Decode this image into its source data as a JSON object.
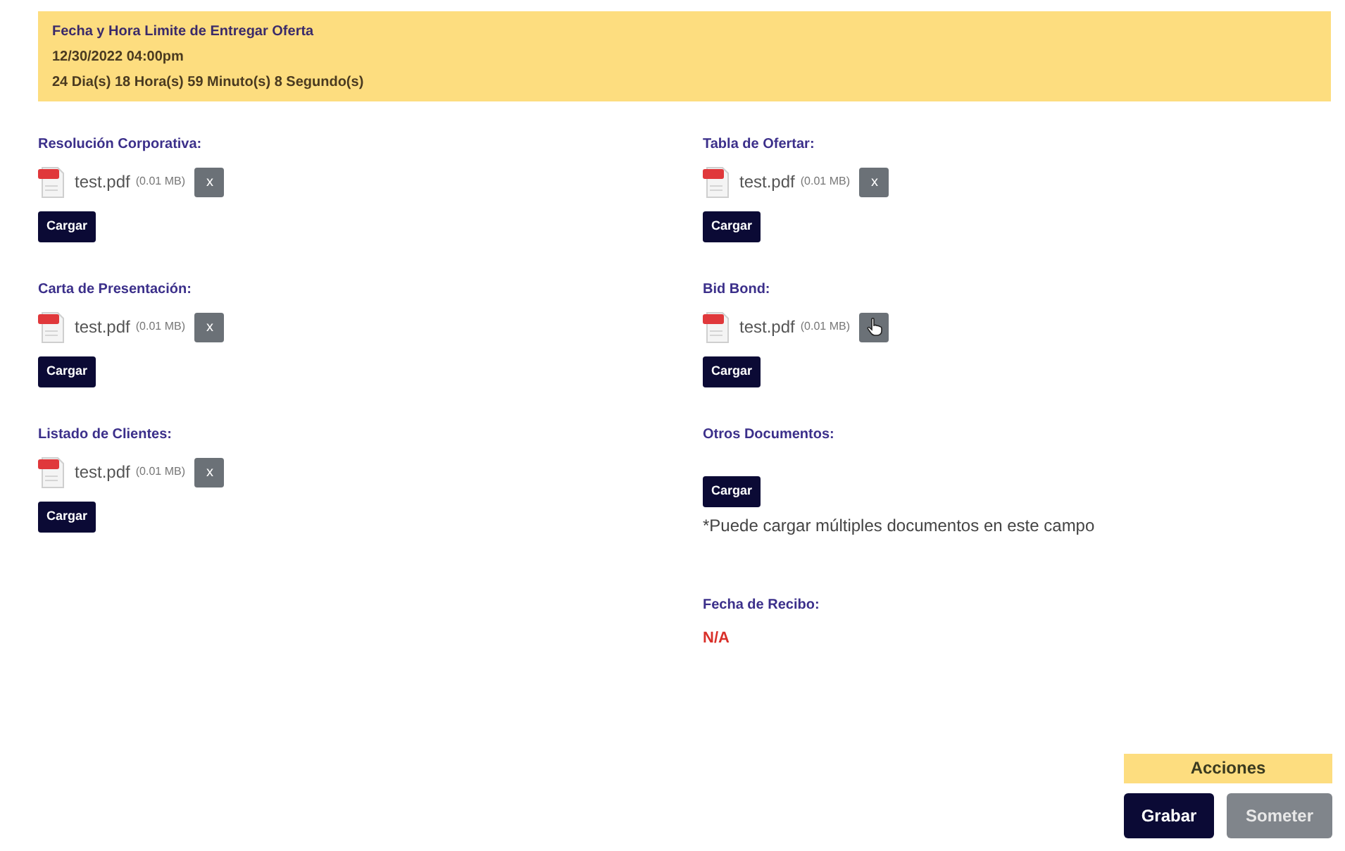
{
  "deadline": {
    "title": "Fecha y Hora Limite de Entregar Oferta",
    "date": "12/30/2022 04:00pm",
    "countdown": "24 Dia(s) 18 Hora(s) 59 Minuto(s) 8 Segundo(s)"
  },
  "left_column": [
    {
      "label": "Resolución Corporativa:",
      "files": [
        {
          "name": "test.pdf",
          "size": "(0.01 MB)",
          "remove": "x",
          "hovered": false
        }
      ],
      "upload_button": "Cargar"
    },
    {
      "label": "Carta de Presentación:",
      "files": [
        {
          "name": "test.pdf",
          "size": "(0.01 MB)",
          "remove": "x",
          "hovered": false
        }
      ],
      "upload_button": "Cargar"
    },
    {
      "label": "Listado de Clientes:",
      "files": [
        {
          "name": "test.pdf",
          "size": "(0.01 MB)",
          "remove": "x",
          "hovered": false
        }
      ],
      "upload_button": "Cargar"
    }
  ],
  "right_column": [
    {
      "label": "Tabla de Ofertar:",
      "files": [
        {
          "name": "test.pdf",
          "size": "(0.01 MB)",
          "remove": "x",
          "hovered": false
        }
      ],
      "upload_button": "Cargar"
    },
    {
      "label": "Bid Bond:",
      "files": [
        {
          "name": "test.pdf",
          "size": "(0.01 MB)",
          "hovered": true
        }
      ],
      "upload_button": "Cargar"
    },
    {
      "label": "Otros Documentos:",
      "upload_button": "Cargar",
      "note": "*Puede cargar múltiples documentos en este campo"
    }
  ],
  "receipt": {
    "label": "Fecha de Recibo:",
    "value": "N/A"
  },
  "actions": {
    "title": "Acciones",
    "buttons": [
      {
        "label": "Grabar",
        "disabled": false
      },
      {
        "label": "Someter",
        "disabled": true
      }
    ]
  }
}
